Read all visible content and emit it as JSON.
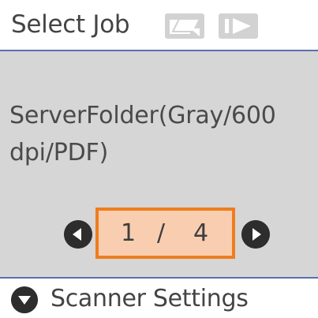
{
  "header": {
    "title": "Select Job",
    "icons": [
      "scan-preset-icon",
      "start-icon"
    ]
  },
  "main": {
    "job_line_1": "ServerFolder(Gray/600",
    "job_line_2": "dpi/PDF)",
    "pager": {
      "current": "1",
      "separator": "/",
      "total": "4"
    }
  },
  "footer": {
    "label": "Scanner Settings"
  },
  "colors": {
    "accent_border": "#ee7d1e",
    "selected_fill": "#f9ceb0",
    "rule": "#5a6fb0",
    "panel_bg": "#d6d6d6"
  }
}
